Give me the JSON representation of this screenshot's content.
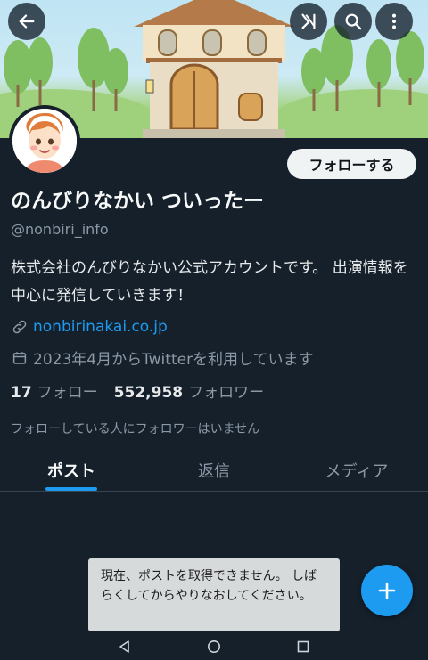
{
  "header": {
    "back_icon": "arrow-left-icon",
    "grok_icon": "grok-icon",
    "search_icon": "search-icon",
    "more_icon": "more-vertical-icon"
  },
  "profile": {
    "follow_label": "フォローする",
    "display_name": "のんびりなかい ついったー",
    "handle": "@nonbiri_info",
    "bio": "株式会社のんびりなかい公式アカウントです。 出演情報を中心に発信していきます！",
    "website": "nonbirinakai.co.jp",
    "joined": "2023年4月からTwitterを利用しています",
    "following_count": "17",
    "following_label": "フォロー",
    "followers_count": "552,958",
    "followers_label": "フォロワー",
    "followers_note": "フォローしている人にフォロワーはいません"
  },
  "tabs": [
    {
      "label": "ポスト"
    },
    {
      "label": "返信"
    },
    {
      "label": "メディア"
    }
  ],
  "toast": {
    "message": "現在、ポストを取得できません。 しばらくしてからやりなおしてください。"
  },
  "colors": {
    "background": "#15202b",
    "accent": "#1d9bf0",
    "muted_text": "#8b98a5"
  }
}
